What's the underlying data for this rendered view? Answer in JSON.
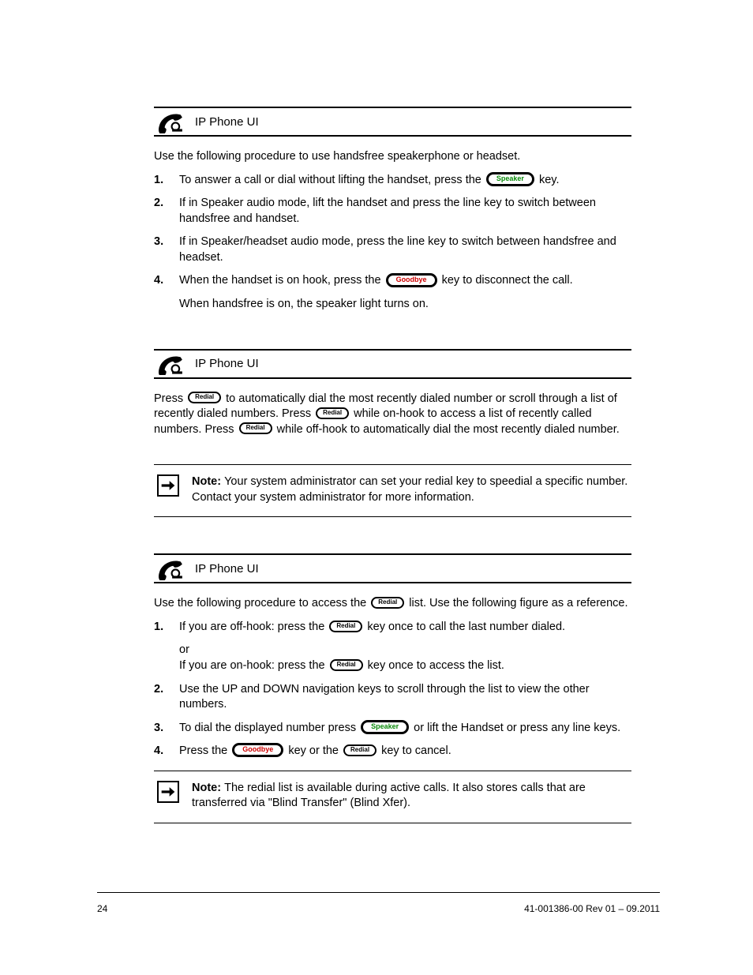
{
  "sections": {
    "sec1": {
      "title": "IP Phone UI",
      "intro": "Use the following procedure to use handsfree speakerphone or headset.",
      "steps": {
        "s1n": "1.",
        "s1a": "To answer a call or dial without lifting the handset, press the ",
        "s1b": " key.",
        "s2n": "2.",
        "s2a": "If in Speaker audio mode, lift the handset and press the line key to switch between handsfree and handset.",
        "s3n": "3.",
        "s3a": "If in Speaker/headset audio mode, press the line key to switch between handsfree and headset.",
        "s4n": "4.",
        "s4a": "When the handset is on hook, press the ",
        "s4b": " key to disconnect the call.",
        "s5text": "When handsfree is on, the speaker light turns on."
      }
    },
    "sec2": {
      "title": "IP Phone UI",
      "intro_a": "Press ",
      "intro_b": "  to automatically dial the most recently dialed number or scroll through a list of recently dialed numbers. Press ",
      "intro_c": " while on-hook to access a list of recently called numbers. Press ",
      "intro_d": " while off-hook to automatically dial the most recently dialed number.",
      "note_a": "Note: ",
      "note_b": "Your system administrator can set your redial key to speedial a specific number. Contact your system administrator for more information."
    },
    "sec3": {
      "title": "IP Phone UI",
      "intro_a": "Use the following procedure to access the ",
      "intro_b": " list. Use the following figure as a reference.",
      "steps": {
        "s1n": "1.",
        "s1a": "If you are off-hook: press the ",
        "s1b": " key once to call the last number dialed.",
        "s2a": "or",
        "s2b": "  If you are on-hook: press the ",
        "s2c": " key once to access the list.",
        "s3n": "2.",
        "s3a": "Use the UP and DOWN navigation keys to scroll through the list to view the other numbers.",
        "s4n": "3.",
        "s4a": "To dial the displayed number press ",
        "s4b": " or lift the Handset or press any line keys.",
        "s5n": "4.",
        "s5a": "Press the ",
        "s5b": " key or the ",
        "s5c": " key to cancel."
      },
      "note_a": "Note: ",
      "note_b": "The redial list is available during active calls. It also stores calls that are transferred via \"Blind Transfer\" (Blind Xfer)."
    }
  },
  "buttons": {
    "speaker": "Speaker",
    "goodbye": "Goodbye",
    "redial": "Redial"
  },
  "footer": {
    "page": "24",
    "doc": "41-001386-00 Rev 01 – 09.2011"
  }
}
